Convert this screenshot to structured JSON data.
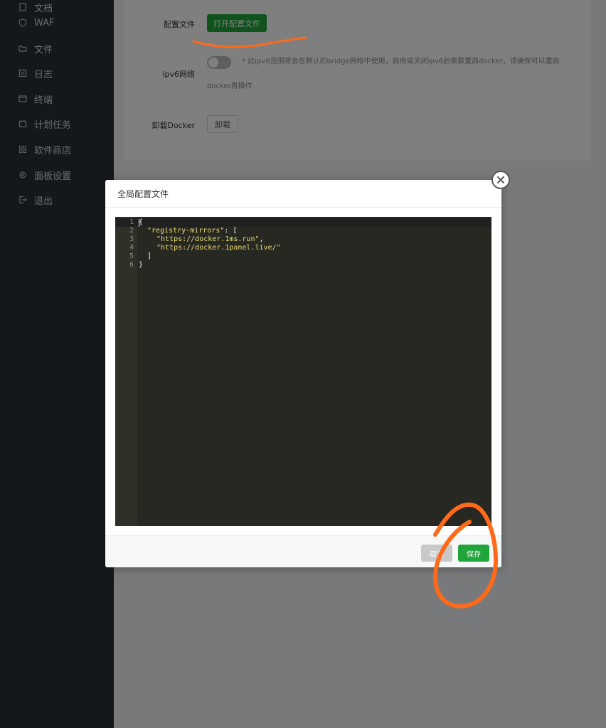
{
  "sidebar": {
    "items": [
      {
        "label": "文档",
        "icon": "files-icon"
      },
      {
        "label": "WAF",
        "icon": "shield-icon"
      },
      {
        "label": "文件",
        "icon": "folder-icon"
      },
      {
        "label": "日志",
        "icon": "log-icon"
      },
      {
        "label": "终端",
        "icon": "terminal-icon"
      },
      {
        "label": "计划任务",
        "icon": "calendar-icon"
      },
      {
        "label": "软件商店",
        "icon": "grid-icon"
      },
      {
        "label": "面板设置",
        "icon": "gear-icon"
      },
      {
        "label": "退出",
        "icon": "logout-icon"
      }
    ]
  },
  "settings": {
    "config_file_label": "配置文件",
    "open_config_button": "打开配置文件",
    "ipv6_label": "ipv6网络",
    "ipv6_enabled": false,
    "ipv6_hint_line1": "* 此ipv6范围将会在默认的bridge网络中使用，启用或关闭ipv6后需要重启docker，请确保可以重启",
    "ipv6_hint_line2": "docker再操作",
    "uninstall_label": "卸载Docker",
    "uninstall_button": "卸载"
  },
  "dialog": {
    "title": "全局配置文件",
    "editor": {
      "line_numbers": [
        "1",
        "2",
        "3",
        "4",
        "5",
        "6"
      ],
      "lines": {
        "l1": "{",
        "l2_key": "\"registry-mirrors\"",
        "l2_rest": ": [",
        "l3": "\"https://docker.1ms.run\"",
        "l3_comma": ",",
        "l4": "\"https://docker.1panel.live/\"",
        "l5": "]",
        "l6": "}"
      }
    },
    "cancel_button": "取消",
    "save_button": "保存"
  },
  "colors": {
    "accent": "#20a53a",
    "sidebar_bg": "#2b3137",
    "annotation": "#ff6a1a"
  }
}
